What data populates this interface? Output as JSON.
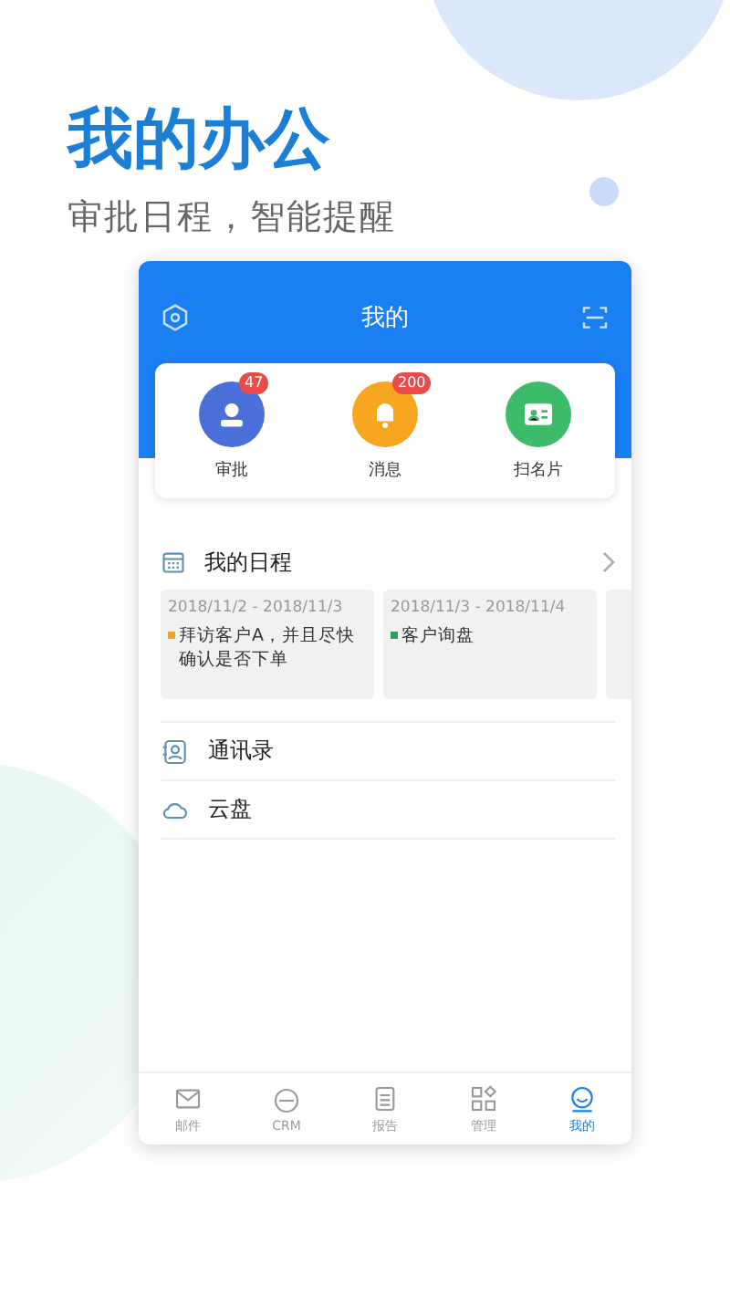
{
  "headline": "我的办公",
  "subtitle": "审批日程，智能提醒",
  "app": {
    "title": "我的",
    "quick_actions": [
      {
        "label": "审批",
        "badge": "47",
        "color": "#4a6fd8",
        "kind": "user"
      },
      {
        "label": "消息",
        "badge": "200",
        "color": "#f7a620",
        "kind": "bell"
      },
      {
        "label": "扫名片",
        "color": "#3dba6a",
        "kind": "card"
      }
    ],
    "schedule": {
      "title": "我的日程",
      "events": [
        {
          "dates": "2018/11/2 - 2018/11/3",
          "text": "拜访客户A，并且尽快确认是否下单",
          "color": "#f0a030"
        },
        {
          "dates": "2018/11/3 - 2018/11/4",
          "text": "客户询盘",
          "color": "#2e9e5e"
        }
      ]
    },
    "menu": [
      {
        "label": "通讯录",
        "kind": "contacts"
      },
      {
        "label": "云盘",
        "kind": "cloud"
      }
    ],
    "tabs": [
      {
        "label": "邮件",
        "kind": "mail",
        "selected": false
      },
      {
        "label": "CRM",
        "kind": "crm",
        "selected": false
      },
      {
        "label": "报告",
        "kind": "report",
        "selected": false
      },
      {
        "label": "管理",
        "kind": "apps",
        "selected": false
      },
      {
        "label": "我的",
        "kind": "me",
        "selected": true
      }
    ]
  }
}
